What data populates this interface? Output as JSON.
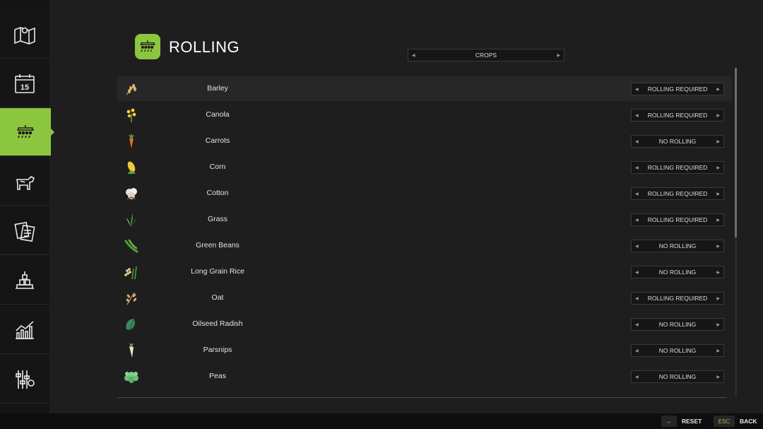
{
  "header": {
    "title": "ROLLING",
    "icon": "roller-icon",
    "accent": "#8cc63f"
  },
  "category_selector": {
    "value": "CROPS"
  },
  "sidebar": {
    "items": [
      {
        "name": "map-icon"
      },
      {
        "name": "calendar-icon",
        "text": "15"
      },
      {
        "name": "roller-icon",
        "active": true
      },
      {
        "name": "animals-icon"
      },
      {
        "name": "contracts-icon"
      },
      {
        "name": "production-icon"
      },
      {
        "name": "statistics-icon"
      },
      {
        "name": "settings-icon"
      }
    ]
  },
  "crops": [
    {
      "name": "Barley",
      "icon": "barley-icon",
      "setting": "ROLLING REQUIRED"
    },
    {
      "name": "Canola",
      "icon": "canola-icon",
      "setting": "ROLLING REQUIRED"
    },
    {
      "name": "Carrots",
      "icon": "carrot-icon",
      "setting": "NO ROLLING"
    },
    {
      "name": "Corn",
      "icon": "corn-icon",
      "setting": "ROLLING REQUIRED"
    },
    {
      "name": "Cotton",
      "icon": "cotton-icon",
      "setting": "ROLLING REQUIRED"
    },
    {
      "name": "Grass",
      "icon": "grass-icon",
      "setting": "ROLLING REQUIRED"
    },
    {
      "name": "Green Beans",
      "icon": "green-beans-icon",
      "setting": "NO ROLLING"
    },
    {
      "name": "Long Grain Rice",
      "icon": "rice-icon",
      "setting": "NO ROLLING"
    },
    {
      "name": "Oat",
      "icon": "oat-icon",
      "setting": "ROLLING REQUIRED"
    },
    {
      "name": "Oilseed Radish",
      "icon": "oilseed-radish-icon",
      "setting": "NO ROLLING"
    },
    {
      "name": "Parsnips",
      "icon": "parsnip-icon",
      "setting": "NO ROLLING"
    },
    {
      "name": "Peas",
      "icon": "peas-icon",
      "setting": "NO ROLLING"
    }
  ],
  "footer": {
    "reset_key": "↔",
    "reset_label": "RESET",
    "back_key": "ESC",
    "back_label": "BACK"
  }
}
